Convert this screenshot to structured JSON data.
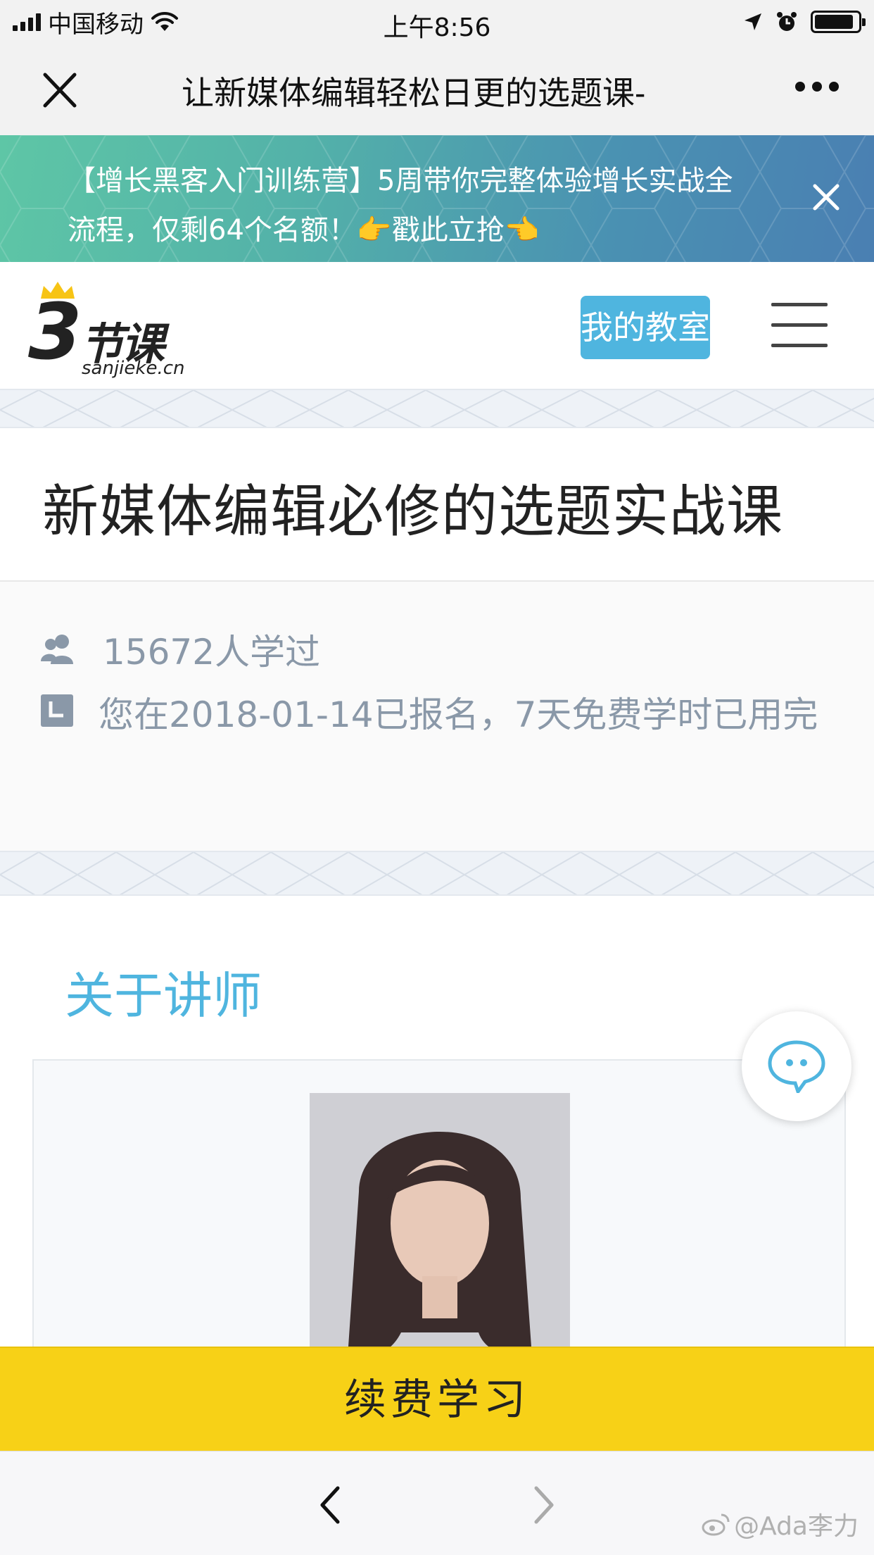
{
  "status_bar": {
    "carrier": "中国移动",
    "time": "上午8:56",
    "battery_level": 0.9,
    "signal_bars": 4
  },
  "navbar": {
    "title": "让新媒体编辑轻松日更的选题课-"
  },
  "banner": {
    "text": "【增长黑客入门训练营】5周带你完整体验增长实战全流程，仅剩64个名额！👉戳此立抢👈"
  },
  "brand": {
    "logo_number": "3",
    "logo_text": "节课",
    "logo_url": "sanjieke.cn",
    "my_classroom_label": "我的教室"
  },
  "course": {
    "title": "新媒体编辑必修的选题实战课",
    "learners": "15672人学过",
    "enrollment_status": "您在2018-01-14已报名，7天免费学时已用完"
  },
  "instructor_section": {
    "title": "关于讲师"
  },
  "cta": {
    "label": "续费学习"
  },
  "watermark": {
    "text": "@Ada李力"
  },
  "colors": {
    "accent_blue": "#4fb5df",
    "cta_yellow": "#f7d117",
    "meta_gray": "#8a98a8",
    "banner_start": "#5ec6a6",
    "banner_end": "#4a7fb2"
  }
}
